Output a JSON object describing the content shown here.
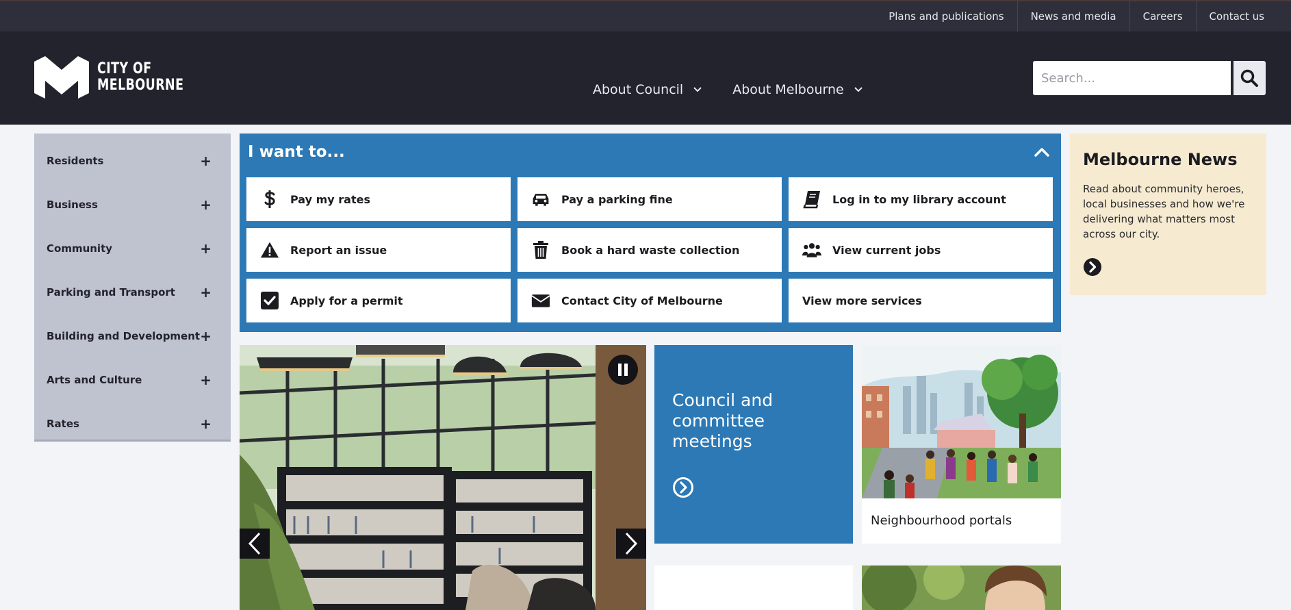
{
  "utility_nav": {
    "items": [
      {
        "label": "Plans and publications"
      },
      {
        "label": "News and media"
      },
      {
        "label": "Careers"
      },
      {
        "label": "Contact us"
      }
    ]
  },
  "header": {
    "logo_line1": "City of",
    "logo_line2": "Melbourne",
    "nav": [
      {
        "label": "About Council",
        "icon": "chevron-down-icon"
      },
      {
        "label": "About Melbourne",
        "icon": "chevron-down-icon"
      }
    ],
    "search": {
      "placeholder": "Search...",
      "value": "",
      "icon": "search-icon"
    }
  },
  "sidebar": {
    "items": [
      {
        "label": "Residents"
      },
      {
        "label": "Business"
      },
      {
        "label": "Community"
      },
      {
        "label": "Parking and Transport"
      },
      {
        "label": "Building and Development"
      },
      {
        "label": "Arts and Culture"
      },
      {
        "label": "Rates"
      }
    ],
    "expand_glyph": "+"
  },
  "i_want_to": {
    "title": "I want to...",
    "collapse_icon": "chevron-up-icon",
    "tiles": [
      {
        "label": "Pay my rates",
        "icon": "dollar-icon"
      },
      {
        "label": "Pay a parking fine",
        "icon": "car-icon"
      },
      {
        "label": "Log in to my library account",
        "icon": "book-icon"
      },
      {
        "label": "Report an issue",
        "icon": "warning-icon"
      },
      {
        "label": "Book a hard waste collection",
        "icon": "trash-icon"
      },
      {
        "label": "View current jobs",
        "icon": "users-icon"
      },
      {
        "label": "Apply for a permit",
        "icon": "checkbox-icon"
      },
      {
        "label": "Contact City of Melbourne",
        "icon": "envelope-icon"
      },
      {
        "label": "View more services",
        "icon": ""
      }
    ]
  },
  "carousel": {
    "pause_icon": "pause-icon",
    "prev_icon": "chevron-left-icon",
    "next_icon": "chevron-right-icon"
  },
  "cards": {
    "council": {
      "title": "Council and committee meetings",
      "icon": "circle-arrow-right-icon"
    },
    "neighbourhood": {
      "label": "Neighbourhood portals"
    }
  },
  "news": {
    "title": "Melbourne News",
    "body": "Read about community heroes, local businesses and how we're delivering what matters most across our city.",
    "icon": "circle-arrow-right-icon"
  },
  "colors": {
    "brand_blue": "#2c79b5",
    "header_dark": "#23232d",
    "utility_dark": "#2e2f3a",
    "sidebar_grey": "#bfc3cf",
    "news_cream": "#f6ead0"
  }
}
